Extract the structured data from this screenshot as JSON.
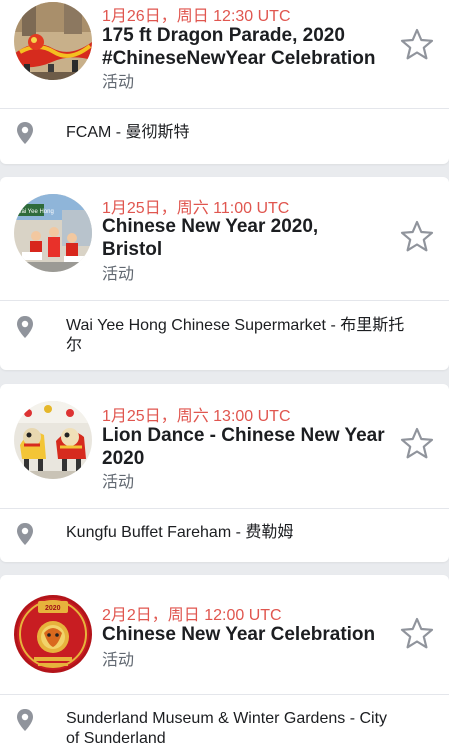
{
  "events": [
    {
      "date": "1月26日，周日 12:30 UTC",
      "title_line1": "175 ft Dragon Parade, 2020",
      "title_line2": "#ChineseNewYear Celebration",
      "type": "活动",
      "location": "FCAM - 曼彻斯特"
    },
    {
      "date": "1月25日，周六 11:00 UTC",
      "title_line1": "Chinese New Year 2020,",
      "title_line2": "Bristol",
      "type": "活动",
      "location_line1": "Wai Yee Hong Chinese Supermarket - 布里斯托",
      "location_line2": "尔",
      "thumb_text": "Wai Yee Hong"
    },
    {
      "date": "1月25日，周六 13:00 UTC",
      "title_line1": "Lion Dance - Chinese New Year",
      "title_line2": "2020",
      "type": "活动",
      "location": "Kungfu Buffet Fareham - 费勒姆"
    },
    {
      "date": "2月2日，周日 12:00 UTC",
      "title_line1": "Chinese New Year Celebration",
      "type": "活动",
      "location_line1": "Sunderland Museum & Winter Gardens - City",
      "location_line2": "of Sunderland",
      "thumb_text": "2020"
    }
  ],
  "colors": {
    "date": "#e0564f",
    "background": "#e9ebee",
    "icon": "#90949c"
  },
  "icons": {
    "star": "star-icon",
    "pin": "location-pin-icon"
  }
}
